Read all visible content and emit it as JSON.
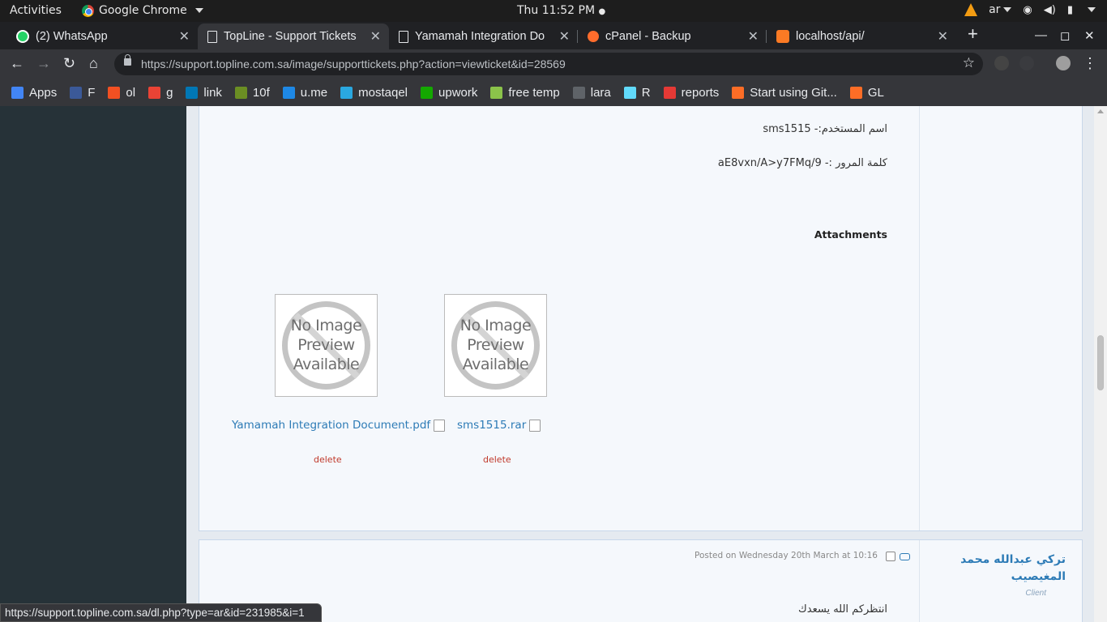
{
  "topbar": {
    "activities": "Activities",
    "app_name": "Google Chrome",
    "clock": "Thu 11:52 PM",
    "lang": "ar"
  },
  "tabs": [
    {
      "title": "(2) WhatsApp",
      "icon": "whatsapp-icon"
    },
    {
      "title": "TopLine - Support Tickets",
      "icon": "document-icon"
    },
    {
      "title": "Yamamah Integration Do",
      "icon": "document-icon"
    },
    {
      "title": "cPanel - Backup",
      "icon": "cpanel-icon"
    },
    {
      "title": "localhost/api/",
      "icon": "xampp-icon"
    }
  ],
  "omnibox": {
    "url": "https://support.topline.com.sa/image/supporttickets.php?action=viewticket&id=28569"
  },
  "bookmarks": [
    {
      "label": "Apps",
      "color": "#4285f4"
    },
    {
      "label": "F",
      "color": "#3b5998"
    },
    {
      "label": "ol",
      "color": "#f25022"
    },
    {
      "label": "g",
      "color": "#ea4335"
    },
    {
      "label": "link",
      "color": "#0077b5"
    },
    {
      "label": "10f",
      "color": "#6b8e23"
    },
    {
      "label": "u.me",
      "color": "#1e88e5"
    },
    {
      "label": "mostaqel",
      "color": "#2aa8e0"
    },
    {
      "label": "upwork",
      "color": "#14a800"
    },
    {
      "label": "free temp",
      "color": "#8bc34a"
    },
    {
      "label": "lara",
      "color": "#5f6368"
    },
    {
      "label": "R",
      "color": "#61dafb"
    },
    {
      "label": "reports",
      "color": "#e53935"
    },
    {
      "label": "Start using Git...",
      "color": "#fc6d26"
    },
    {
      "label": "GL",
      "color": "#fc6d26"
    }
  ],
  "ticket": {
    "username_line": "اسم المستخدم:- sms1515",
    "password_line": "كلمة المرور :- aE8vxn/A>y7FMq/9",
    "attachments_title": "Attachments",
    "no_preview_text": [
      "No Image",
      "Preview",
      "Available"
    ],
    "attachments": [
      {
        "filename": "Yamamah Integration Document.pdf",
        "delete_label": "delete"
      },
      {
        "filename": "sms1515.rar",
        "delete_label": "delete"
      }
    ]
  },
  "reply": {
    "posted": "Posted on Wednesday 20th March at 10:16",
    "author": "تركي عبدالله محمد المغيصيب",
    "role": "Client",
    "text": "انتظركم الله يسعدك"
  },
  "status_url": "https://support.topline.com.sa/dl.php?type=ar&id=231985&i=1"
}
